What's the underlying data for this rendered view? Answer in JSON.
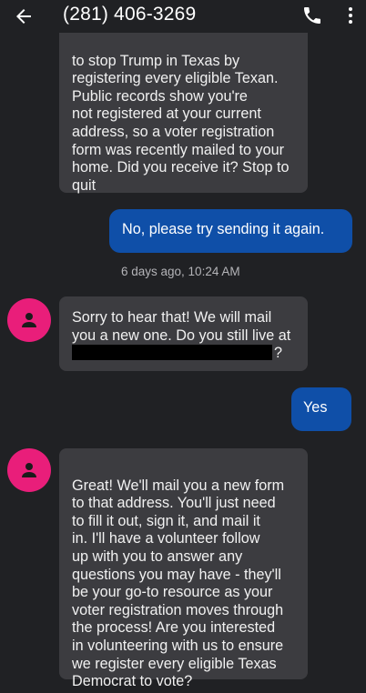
{
  "header": {
    "contact": "(281) 406-3269"
  },
  "messages": {
    "m1": "to stop Trump in Texas by\nregistering every eligible Texan.\nPublic records show you're\nnot registered at your current\naddress, so a voter registration\nform was recently mailed to your\nhome. Did you receive it? Stop to\nquit",
    "m2": "No, please try sending it again.",
    "timestamp": "6 days ago, 10:24 AM",
    "m3_part1": "Sorry to hear that! We will mail you a new one. Do you still live at ",
    "m3_part2": "?",
    "m4": "Yes",
    "m5": "Great! We'll mail you a new form\nto that address. You'll just need\nto fill it out, sign it, and mail it\nin. I'll have a volunteer follow\nup with you to answer any\nquestions you may have - they'll\nbe your go-to resource as your\nvoter registration moves through\nthe process! Are you interested\nin volunteering with us to ensure\nwe register every eligible Texas\nDemocrat to vote?"
  },
  "colors": {
    "background": "#202124",
    "incoming_bubble": "#3c3c40",
    "outgoing_bubble": "#0f4fa8",
    "avatar": "#e91e7a"
  },
  "icons": [
    "back-arrow-icon",
    "phone-icon",
    "more-vert-icon",
    "person-icon"
  ]
}
